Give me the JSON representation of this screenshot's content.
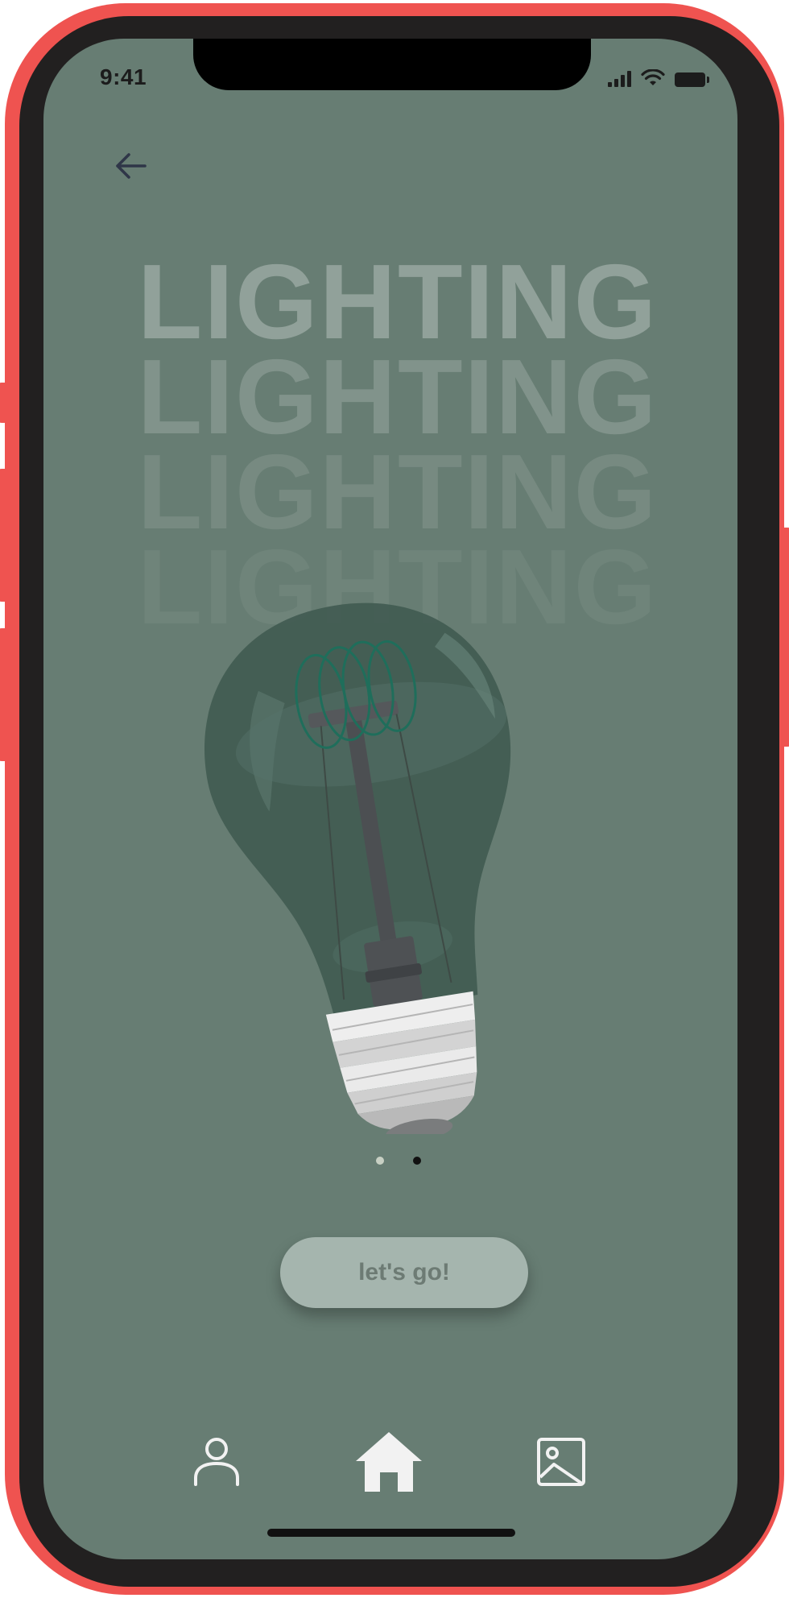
{
  "status_bar": {
    "time": "9:41",
    "icons": [
      "cellular-signal-icon",
      "wifi-icon",
      "battery-icon"
    ]
  },
  "header": {
    "back_icon": "arrow-left-icon"
  },
  "hero": {
    "words": [
      "LIGHTING",
      "LIGHTING",
      "LIGHTING",
      "LIGHTING"
    ],
    "word_opacities": [
      0.28,
      0.18,
      0.11,
      0.06
    ],
    "image": "light-bulb-illustration"
  },
  "pagination": {
    "pages": 2,
    "active_index": 1
  },
  "cta": {
    "label": "let's go!"
  },
  "tab_bar": {
    "items": [
      {
        "icon": "user-icon",
        "active": false
      },
      {
        "icon": "home-icon",
        "active": true
      },
      {
        "icon": "image-icon",
        "active": false
      }
    ]
  },
  "colors": {
    "screen_bg": "#677d73",
    "frame": "#ef5350",
    "bezel": "#222020",
    "button_bg": "#a5b5ae",
    "button_text": "#6d7b74",
    "dot_inactive": "#c8d0c4",
    "dot_active": "#111111",
    "icon_light": "#f2f2f2"
  }
}
